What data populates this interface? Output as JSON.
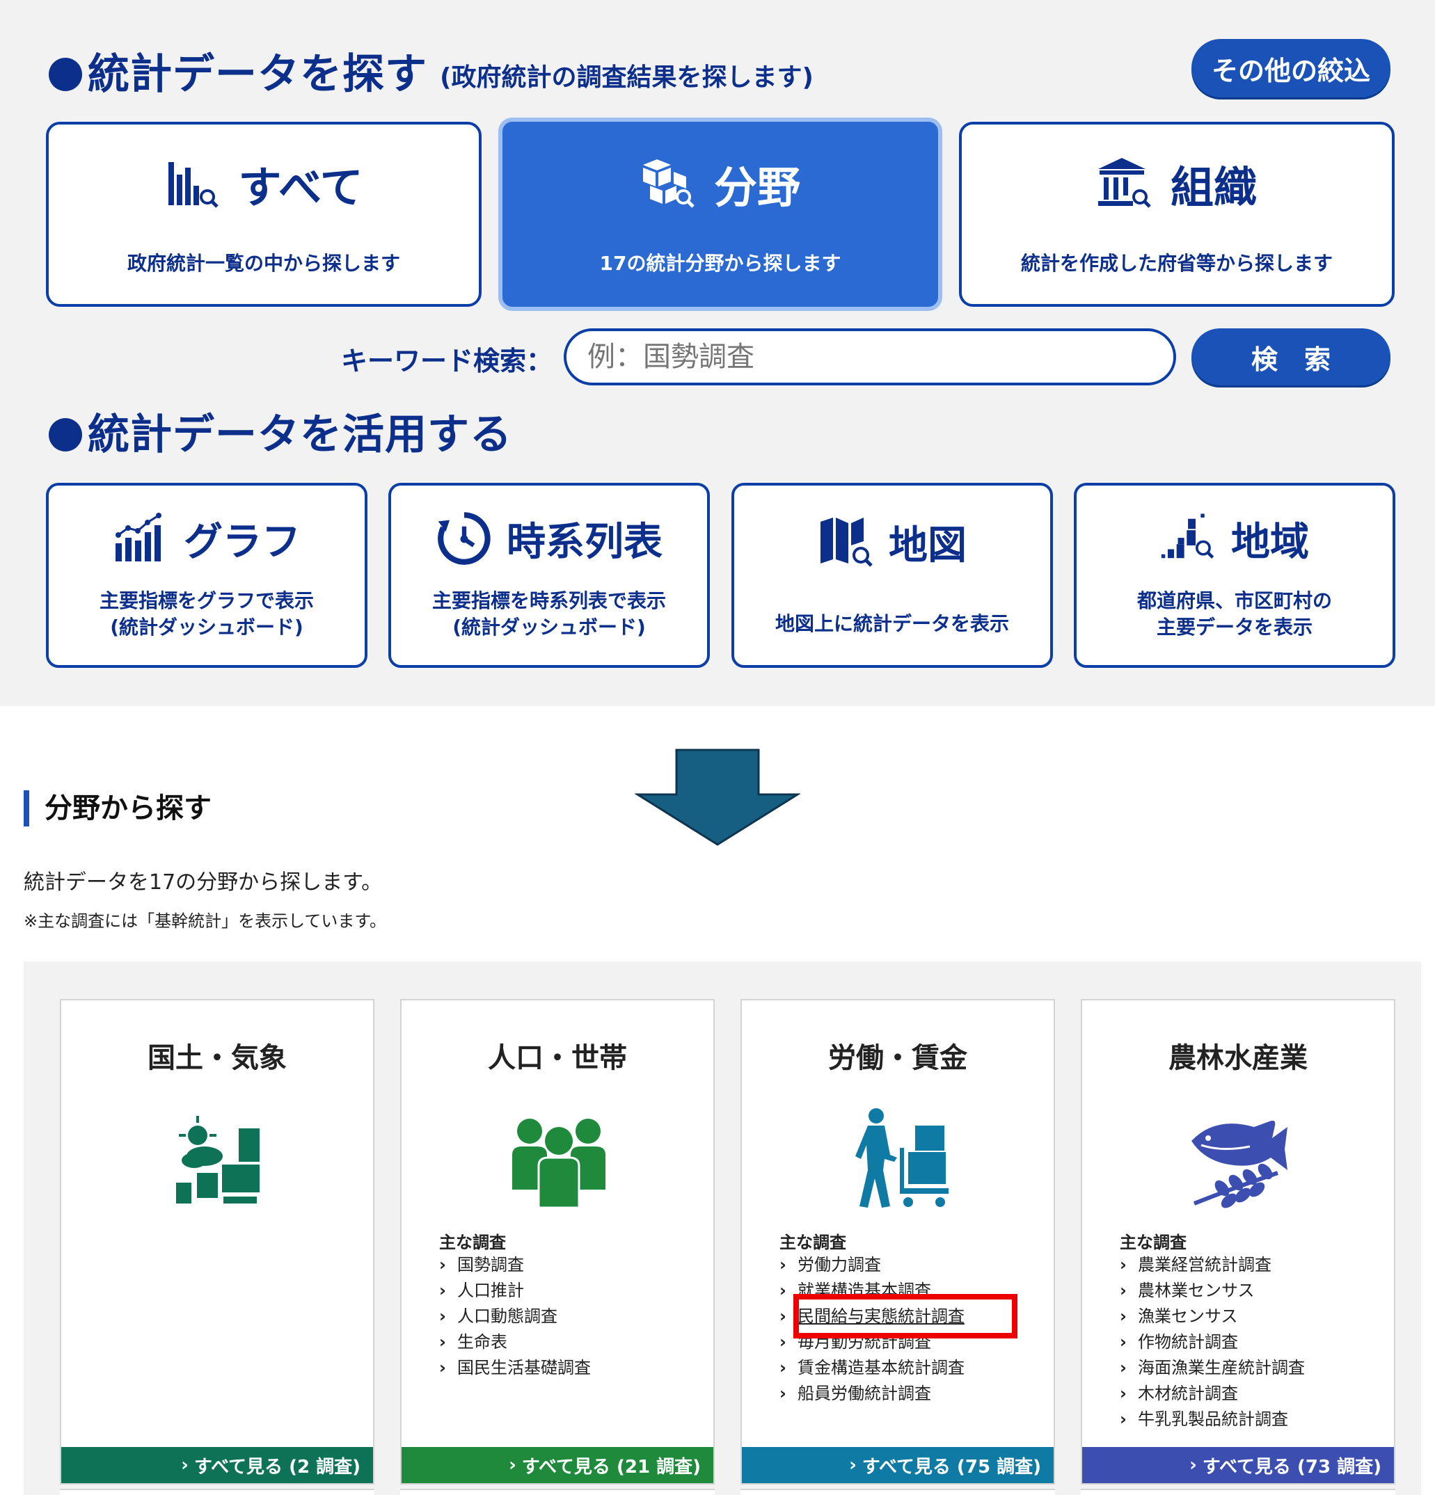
{
  "search_section": {
    "title": "統計データを探す",
    "subtitle": "(政府統計の調査結果を探します)",
    "filter_button": "その他の絞込",
    "cards": [
      {
        "title": "すべて",
        "desc": "政府統計一覧の中から探します",
        "icon": "bar-chart-search-icon"
      },
      {
        "title": "分野",
        "desc": "17の統計分野から探します",
        "icon": "blocks-search-icon"
      },
      {
        "title": "組織",
        "desc": "統計を作成した府省等から探します",
        "icon": "building-search-icon"
      }
    ],
    "keyword_label": "キーワード検索：",
    "keyword_placeholder": "例：国勢調査",
    "search_button": "検　索"
  },
  "use_section": {
    "title": "統計データを活用する",
    "cards": [
      {
        "title": "グラフ",
        "desc1": "主要指標をグラフで表示",
        "desc2": "(統計ダッシュボード)",
        "icon": "graph-icon"
      },
      {
        "title": "時系列表",
        "desc1": "主要指標を時系列表で表示",
        "desc2": "(統計ダッシュボード)",
        "icon": "clock-icon"
      },
      {
        "title": "地図",
        "desc1": "地図上に統計データを表示",
        "desc2": "",
        "icon": "map-search-icon"
      },
      {
        "title": "地域",
        "desc1": "都道府県、市区町村の",
        "desc2": "主要データを表示",
        "icon": "region-chart-icon"
      }
    ]
  },
  "field_section": {
    "title": "分野から探す",
    "description": "統計データを17の分野から探します。",
    "note": "※主な調査には「基幹統計」を表示しています。",
    "survey_heading": "主な調査",
    "categories": [
      {
        "title": "国土・気象",
        "icon": "weather-icon",
        "color": "#0e7356",
        "see_all": "すべて見る (2 調査)",
        "surveys": []
      },
      {
        "title": "人口・世帯",
        "icon": "people-icon",
        "color": "#1f8a3c",
        "see_all": "すべて見る (21 調査)",
        "surveys": [
          "国勢調査",
          "人口推計",
          "人口動態調査",
          "生命表",
          "国民生活基礎調査"
        ]
      },
      {
        "title": "労働・賃金",
        "icon": "worker-cart-icon",
        "color": "#0f7aa3",
        "see_all": "すべて見る (75 調査)",
        "surveys": [
          "労働力調査",
          "就業構造基本調査",
          "民間給与実態統計調査",
          "毎月勤労統計調査",
          "賃金構造基本統計調査",
          "船員労働統計調査"
        ]
      },
      {
        "title": "農林水産業",
        "icon": "fish-wheat-icon",
        "color": "#3c4fb0",
        "see_all": "すべて見る (73 調査)",
        "surveys": [
          "農業経営統計調査",
          "農林業センサス",
          "漁業センサス",
          "作物統計調査",
          "海面漁業生産統計調査",
          "木材統計調査",
          "牛乳乳製品統計調査"
        ]
      }
    ]
  },
  "colors": {
    "navy": "#0c2f8c",
    "button_blue": "#1a52b8",
    "active_card": "#2a6ad2",
    "arrow": "#175e83",
    "highlight": "#ee0000"
  }
}
